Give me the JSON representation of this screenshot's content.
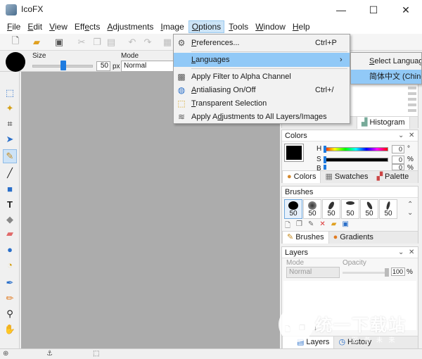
{
  "window": {
    "title": "IcoFX",
    "minimize": "—",
    "maximize": "☐",
    "close": "✕"
  },
  "menubar": [
    {
      "label": "File",
      "ul": "F",
      "rest": "ile"
    },
    {
      "label": "Edit",
      "ul": "E",
      "rest": "dit"
    },
    {
      "label": "View",
      "ul": "V",
      "rest": "iew"
    },
    {
      "label": "Effects",
      "pre": "Eff",
      "ul": "e",
      "rest": "cts"
    },
    {
      "label": "Adjustments",
      "ul": "A",
      "rest": "djustments"
    },
    {
      "label": "Image",
      "ul": "I",
      "rest": "mage"
    },
    {
      "label": "Options",
      "ul": "O",
      "rest": "ptions"
    },
    {
      "label": "Tools",
      "ul": "T",
      "rest": "ools"
    },
    {
      "label": "Window",
      "ul": "W",
      "rest": "indow"
    },
    {
      "label": "Help",
      "ul": "H",
      "rest": "elp"
    }
  ],
  "options_bar": {
    "size_label": "Size",
    "size_value": "50",
    "size_unit": "px",
    "mode_label": "Mode",
    "mode_value": "Normal"
  },
  "options_menu": {
    "preferences": {
      "label": "Preferences...",
      "shortcut": "Ctrl+P"
    },
    "languages": {
      "label": "Languages",
      "arrow": "›"
    },
    "apply_filter": {
      "label": "Apply Filter to Alpha Channel"
    },
    "antialiasing": {
      "label": "Antialiasing On/Off",
      "shortcut": "Ctrl+/"
    },
    "transparent": {
      "label": "Transparent Selection"
    },
    "apply_adjust": {
      "label": "Apply Adjustments to All Layers/Images"
    }
  },
  "languages_submenu": {
    "select": "Select Language",
    "chinese": "简体中文 (Chinese)"
  },
  "panels": {
    "top_tabs": {
      "histogram": "Histogram"
    },
    "colors": {
      "title": "Colors",
      "h": {
        "label": "H",
        "value": "0",
        "unit": "°"
      },
      "s": {
        "label": "S",
        "value": "0",
        "unit": "%"
      },
      "b": {
        "label": "B",
        "value": "0",
        "unit": "%"
      },
      "tabs": {
        "colors": "Colors",
        "swatches": "Swatches",
        "palette": "Palette"
      }
    },
    "brushes": {
      "title": "Brushes",
      "sizes": [
        "50",
        "50",
        "50",
        "50",
        "50",
        "50"
      ],
      "tabs": {
        "brushes": "Brushes",
        "gradients": "Gradients"
      }
    },
    "layers": {
      "title": "Layers",
      "mode_label": "Mode",
      "opacity_label": "Opacity",
      "mode_value": "Normal",
      "opacity_value": "100",
      "opacity_unit": "%",
      "tabs": {
        "layers": "Layers",
        "history": "History"
      }
    }
  },
  "watermark": {
    "text": "统一下载站",
    "sub": "服 务 未 来"
  },
  "colors": {
    "accent": "#1e7be0",
    "menu_highlight": "#91c9f7",
    "canvas": "#acacac"
  }
}
